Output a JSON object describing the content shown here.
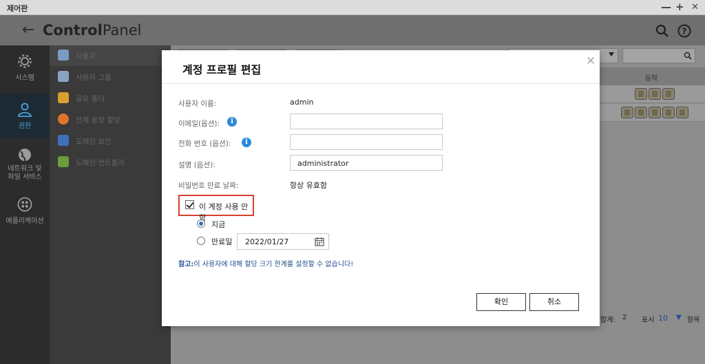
{
  "window": {
    "title": "제어판",
    "minimize": "—",
    "maximize": "+",
    "close": "✕"
  },
  "header": {
    "back_icon": "arrow-left-icon",
    "title_bold": "Control",
    "title_regular": "Panel"
  },
  "rail": {
    "items": [
      {
        "label": "시스템",
        "icon": "gear-icon",
        "active": false
      },
      {
        "label": "권한",
        "icon": "user-icon",
        "active": true
      },
      {
        "label": "네트워크 및 파일 서비스",
        "icon": "globe-icon",
        "active": false
      },
      {
        "label": "애플리케이션",
        "icon": "apps-icon",
        "active": false
      }
    ]
  },
  "submenu": {
    "items": [
      {
        "label": "사용자",
        "active": true,
        "color": "#7a9cc2"
      },
      {
        "label": "사용자 그룹",
        "active": false,
        "color": "#8aa3c3"
      },
      {
        "label": "공유 폴더",
        "active": false,
        "color": "#d8a02b"
      },
      {
        "label": "전체 용량 할당",
        "active": false,
        "color": "#e0742a"
      },
      {
        "label": "도메인 보안",
        "active": false,
        "color": "#3f71b8"
      },
      {
        "label": "도메인 컨트롤러",
        "active": false,
        "color": "#6b9d3d"
      }
    ]
  },
  "table": {
    "action_header": "동작",
    "footer": {
      "total_label": "합계:",
      "total": "2",
      "display_label": "표시",
      "per_page": "10",
      "items_label": "항목"
    }
  },
  "dialog": {
    "title": "계정 프로필 편집",
    "username_label": "사용자 이름:",
    "username": "admin",
    "email_label": "이메일(옵션):",
    "email_value": "",
    "phone_label": "전화 번호 (옵션):",
    "phone_value": "",
    "description_label": "설명 (옵션):",
    "description_value": "administrator",
    "expiry_label": "비밀번호 만료 날짜:",
    "expiry_value": "항상 유효함",
    "disable_checkbox_label": "이 계정 사용 안 함",
    "disable_checked": true,
    "radio_now_label": "지금",
    "radio_expiry_label": "만료일",
    "expiry_date": "2022/01/27",
    "note_prefix": "참고:",
    "note_text": "이 사용자에 대해 할당 크기 한계를 설정할 수 없습니다!",
    "confirm_label": "확인",
    "cancel_label": "취소"
  },
  "colors": {
    "accent": "#2a8ad6",
    "highlight": "#d8402f",
    "note": "#1f4f8e"
  }
}
